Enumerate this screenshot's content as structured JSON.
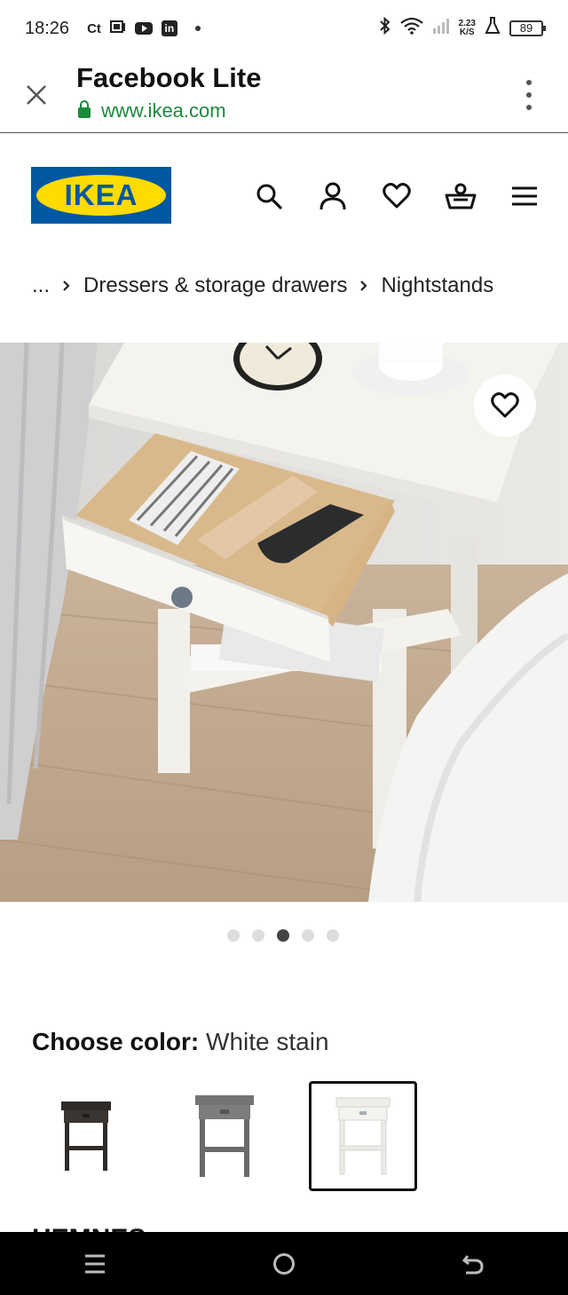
{
  "status_bar": {
    "time": "18:26",
    "app_icons": [
      "ct-icon",
      "image-icon",
      "youtube-icon",
      "linkedin-icon"
    ],
    "ct_label": "Ct",
    "in_label": "in",
    "speed_value": "2.23",
    "speed_unit": "K/S",
    "battery": "89"
  },
  "browser": {
    "title": "Facebook Lite",
    "url": "www.ikea.com"
  },
  "ikea": {
    "logo_text": "IKEA",
    "nav_icons": [
      "search-icon",
      "account-icon",
      "favorites-icon",
      "basket-icon",
      "menu-icon"
    ]
  },
  "breadcrumb": {
    "ellipsis": "...",
    "items": [
      "Dressers & storage drawers",
      "Nightstands"
    ]
  },
  "gallery": {
    "dot_count": 5,
    "active_dot": 3
  },
  "color_picker": {
    "label": "Choose color:",
    "value": "White stain",
    "options": [
      {
        "name": "black-brown",
        "color": "#2f2b28"
      },
      {
        "name": "gray",
        "color": "#6e6e6e"
      },
      {
        "name": "white stain",
        "color": "#f4f3ef",
        "selected": true
      }
    ]
  },
  "product": {
    "name": "HEMNES"
  }
}
